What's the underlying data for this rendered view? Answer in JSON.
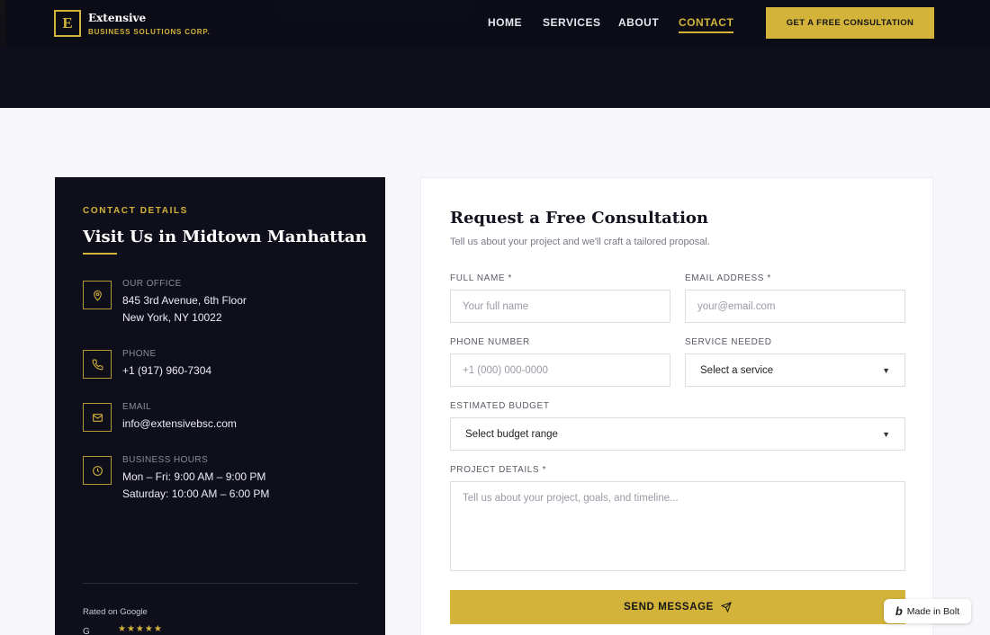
{
  "header": {
    "logo_mark": "E",
    "brand_name": "Extensive",
    "brand_tagline": "BUSINESS SOLUTIONS CORP.",
    "nav": [
      {
        "label": "HOME"
      },
      {
        "label": "SERVICES"
      },
      {
        "label": "ABOUT"
      },
      {
        "label": "CONTACT",
        "active": true
      }
    ],
    "cta_label": "GET A FREE CONSULTATION"
  },
  "contact": {
    "kicker": "CONTACT DETAILS",
    "title": "Visit Us in Midtown Manhattan",
    "items": [
      {
        "icon": "map-pin-icon",
        "label": "OUR OFFICE",
        "lines": [
          "845 3rd Avenue, 6th Floor",
          "New York, NY 10022"
        ]
      },
      {
        "icon": "phone-icon",
        "label": "PHONE",
        "lines": [
          "+1 (917) 960-7304"
        ]
      },
      {
        "icon": "mail-icon",
        "label": "EMAIL",
        "lines": [
          "info@extensivebsc.com"
        ]
      },
      {
        "icon": "clock-icon",
        "label": "BUSINESS HOURS",
        "lines": [
          "Mon – Fri: 9:00 AM – 9:00 PM",
          "Saturday: 10:00 AM – 6:00 PM"
        ]
      }
    ],
    "rated_label": "Rated on Google",
    "stars": "★★★★★",
    "partial_text": "G"
  },
  "form": {
    "title": "Request a Free Consultation",
    "subtitle": "Tell us about your project and we'll craft a tailored proposal.",
    "full_name": {
      "label": "FULL NAME *",
      "placeholder": "Your full name",
      "value": ""
    },
    "email": {
      "label": "EMAIL ADDRESS *",
      "placeholder": "your@email.com",
      "value": ""
    },
    "phone": {
      "label": "PHONE NUMBER",
      "placeholder": "+1 (000) 000-0000",
      "value": ""
    },
    "service": {
      "label": "SERVICE NEEDED",
      "selected": "Select a service"
    },
    "budget": {
      "label": "ESTIMATED BUDGET",
      "selected": "Select budget range"
    },
    "details": {
      "label": "PROJECT DETAILS *",
      "placeholder": "Tell us about your project, goals, and timeline...",
      "value": ""
    },
    "submit_label": "SEND MESSAGE"
  },
  "badge": {
    "mark": "b",
    "label": "Made in Bolt"
  },
  "colors": {
    "accent": "#d3b33a",
    "dark": "#0f0f1c",
    "page_bg": "#f7f7fb"
  }
}
